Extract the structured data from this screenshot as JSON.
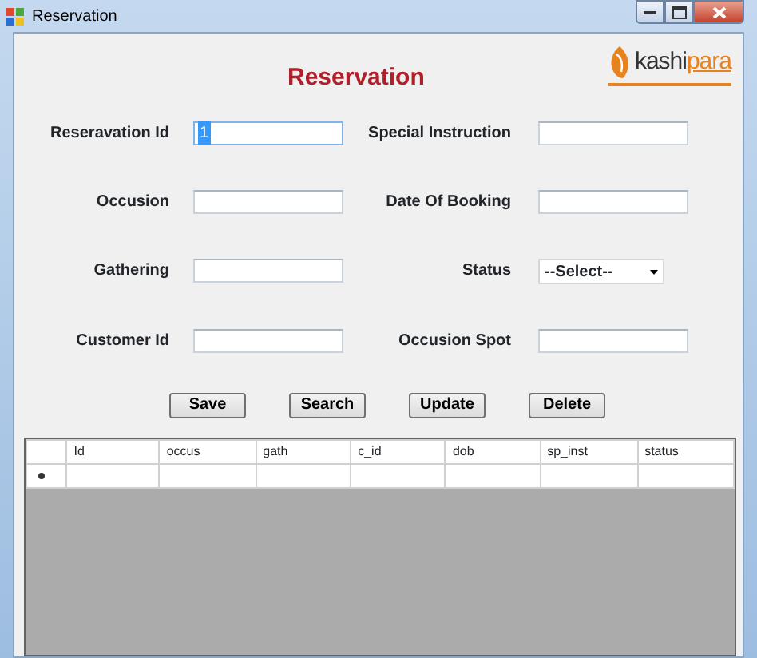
{
  "window": {
    "title": "Reservation"
  },
  "header": {
    "title": "Reservation",
    "logo": {
      "prefix": "kashi",
      "suffix": "para"
    }
  },
  "form": {
    "fields": [
      {
        "label": "Reseravation Id",
        "kind": "text",
        "value": "1",
        "focused": true
      },
      {
        "label": "Special Instruction",
        "kind": "text",
        "focused": false
      },
      {
        "label": "Occusion",
        "kind": "text",
        "focused": false
      },
      {
        "label": "Date Of Booking",
        "kind": "text",
        "focused": false
      },
      {
        "label": "Gathering",
        "kind": "text",
        "focused": false
      },
      {
        "label": "Status",
        "kind": "select",
        "value": "--Select--",
        "focused": false
      },
      {
        "label": "Customer Id",
        "kind": "text",
        "focused": false
      },
      {
        "label": "Occusion Spot",
        "kind": "text",
        "focused": false
      }
    ]
  },
  "buttons": [
    "Save",
    "Search",
    "Update",
    "Delete"
  ],
  "grid": {
    "columns": [
      "Id",
      "occus",
      "gath",
      "c_id",
      "dob",
      "sp_inst",
      "status"
    ],
    "new_row": true
  }
}
